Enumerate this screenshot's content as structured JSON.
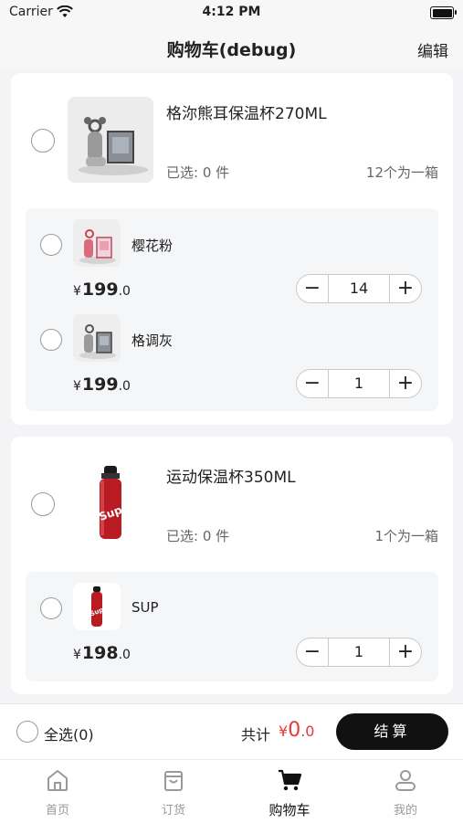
{
  "status_bar": {
    "carrier": "Carrier",
    "time": "4:12 PM"
  },
  "nav": {
    "title": "购物车(debug)",
    "edit_label": "编辑"
  },
  "cart": [
    {
      "name": "格沵熊耳保温杯270ML",
      "selected_text": "已选: 0 件",
      "box_note": "12个为一箱",
      "variants": [
        {
          "name": "樱花粉",
          "price_int": "199",
          "price_dec": ".0",
          "qty": "14"
        },
        {
          "name": "格调灰",
          "price_int": "199",
          "price_dec": ".0",
          "qty": "1"
        }
      ]
    },
    {
      "name": "运动保温杯350ML",
      "selected_text": "已选: 0 件",
      "box_note": "1个为一箱",
      "variants": [
        {
          "name": "SUP",
          "price_int": "198",
          "price_dec": ".0",
          "qty": "1"
        }
      ]
    }
  ],
  "currency": "¥",
  "footer": {
    "select_all": "全选(0)",
    "total_label": "共计",
    "total_int": "0",
    "total_dec": ".0",
    "checkout": "结算"
  },
  "tabs": [
    {
      "label": "首页",
      "icon": "home-icon"
    },
    {
      "label": "订货",
      "icon": "bag-icon"
    },
    {
      "label": "购物车",
      "icon": "cart-icon",
      "active": true
    },
    {
      "label": "我的",
      "icon": "user-icon"
    }
  ],
  "colors": {
    "accent_red": "#e63b35",
    "checkout_bg": "#111111",
    "page_bg": "#f4f4f6"
  }
}
